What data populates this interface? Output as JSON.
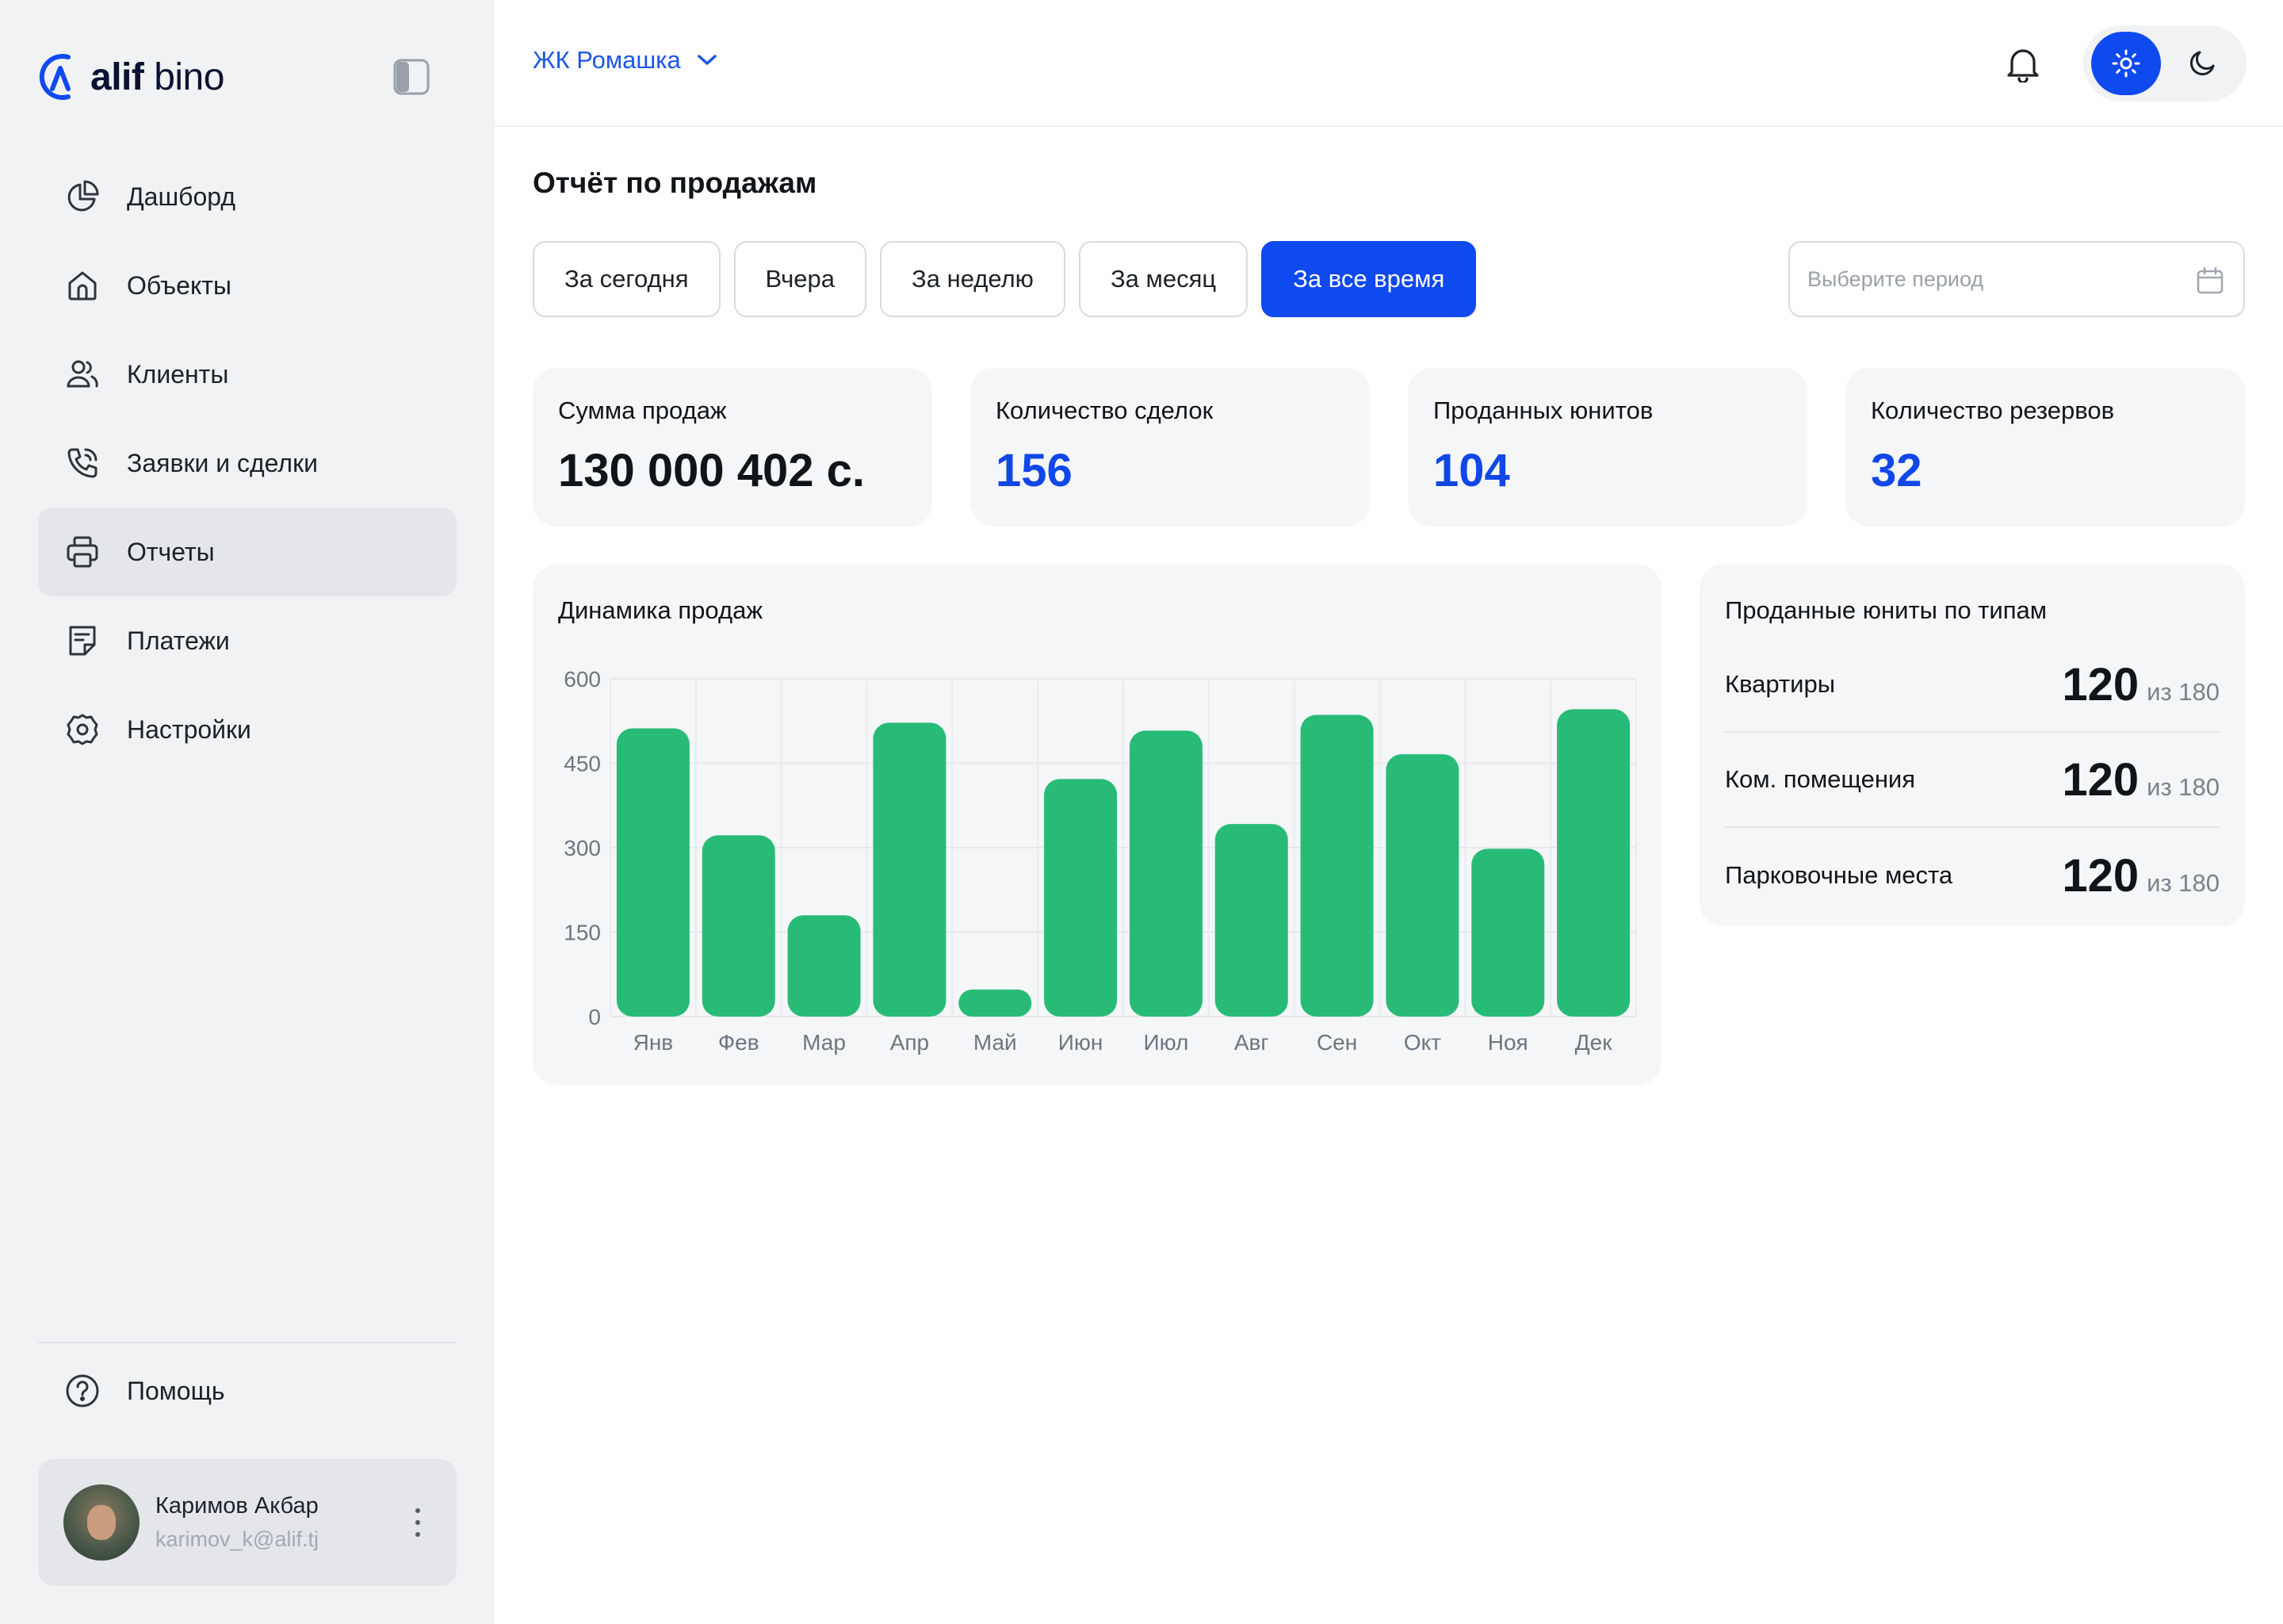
{
  "brand": {
    "name_bold": "alif",
    "name_light": " bino"
  },
  "sidebar": {
    "items": [
      {
        "label": "Дашборд",
        "icon": "pie-chart-icon"
      },
      {
        "label": "Объекты",
        "icon": "home-icon"
      },
      {
        "label": "Клиенты",
        "icon": "users-icon"
      },
      {
        "label": "Заявки и сделки",
        "icon": "phone-icon"
      },
      {
        "label": "Отчеты",
        "icon": "printer-icon",
        "active": true
      },
      {
        "label": "Платежи",
        "icon": "receipt-icon"
      },
      {
        "label": "Настройки",
        "icon": "gear-icon"
      }
    ],
    "help_label": "Помощь",
    "user": {
      "name": "Каримов Акбар",
      "email": "karimov_k@alif.tj"
    }
  },
  "header": {
    "project": "ЖК Ромашка",
    "theme": "light"
  },
  "page": {
    "title": "Отчёт по продажам",
    "filters": [
      "За сегодня",
      "Вчера",
      "За неделю",
      "За месяц",
      "За все время"
    ],
    "active_filter": "За все время",
    "period_placeholder": "Выберите период"
  },
  "stats": [
    {
      "label": "Сумма продаж",
      "value": "130 000 402 с."
    },
    {
      "label": "Количество сделок",
      "value": "156"
    },
    {
      "label": "Проданных юнитов",
      "value": "104"
    },
    {
      "label": "Количество резервов",
      "value": "32"
    }
  ],
  "unit_types": {
    "title": "Проданные юниты по типам",
    "rows": [
      {
        "label": "Квартиры",
        "count": "120",
        "of": "из 180"
      },
      {
        "label": "Ком. помещения",
        "count": "120",
        "of": "из 180"
      },
      {
        "label": "Парковочные места",
        "count": "120",
        "of": "из 180"
      }
    ]
  },
  "colors": {
    "accent": "#0F49F0",
    "bar": "#28BB78",
    "card_bg": "#F5F6F7",
    "sidebar_bg": "#F1F2F4"
  },
  "chart_data": {
    "type": "bar",
    "title": "Динамика продаж",
    "categories": [
      "Янв",
      "Фев",
      "Мар",
      "Апр",
      "Май",
      "Июн",
      "Июл",
      "Авг",
      "Сен",
      "Окт",
      "Ноя",
      "Дек"
    ],
    "values": [
      512,
      322,
      180,
      522,
      48,
      422,
      508,
      342,
      536,
      466,
      298,
      546
    ],
    "ylim": [
      0,
      600
    ],
    "yticks": [
      "0",
      "150",
      "300",
      "450",
      "600"
    ],
    "grid": true,
    "xlabel": "",
    "ylabel": ""
  }
}
